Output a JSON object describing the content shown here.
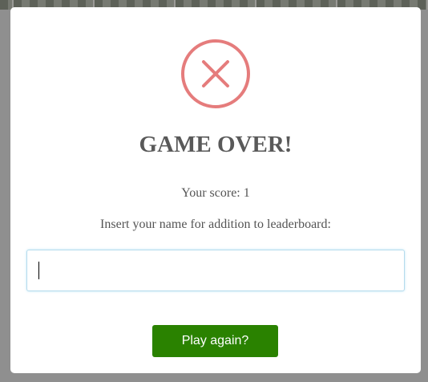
{
  "modal": {
    "icon": "error-x-icon",
    "icon_color": "#e57c7c",
    "title": "GAME OVER!",
    "score_text": "Your score: 1",
    "prompt": "Insert your name for addition to leaderboard:",
    "name_input": {
      "value": "",
      "placeholder": ""
    },
    "play_again_label": "Play again?",
    "play_again_color": "#2a8200"
  }
}
